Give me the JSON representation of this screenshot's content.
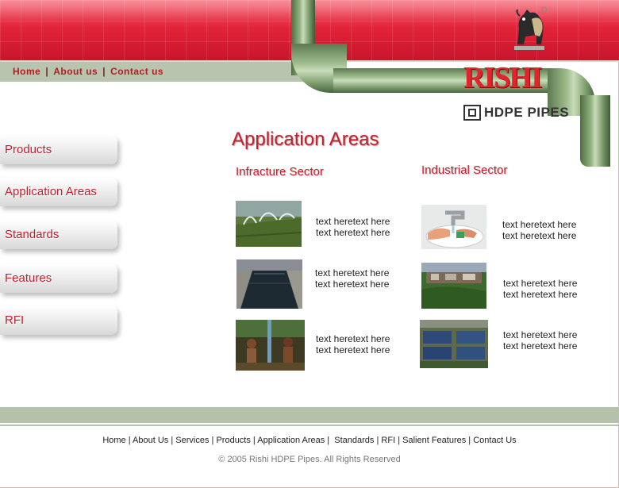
{
  "header": {
    "nav": [
      "Home",
      "About us",
      "Contact us"
    ],
    "nav_sep": "|",
    "logo": {
      "name": "RISHI",
      "subtitle": "HDPE PIPES"
    }
  },
  "sidebar": {
    "items": [
      {
        "label": "Products"
      },
      {
        "label": "Application Areas"
      },
      {
        "label": "Standards"
      },
      {
        "label": "Features"
      },
      {
        "label": "RFI"
      }
    ]
  },
  "main": {
    "title": "Application Areas",
    "sectors": [
      {
        "title": "Infracture Sector",
        "items": [
          {
            "image": "sprinkler-irrigation",
            "line1": "text heretext here",
            "line2": "text heretext here"
          },
          {
            "image": "water-channel",
            "line1": "text heretext here",
            "line2": "text heretext here"
          },
          {
            "image": "workers-pipe",
            "line1": "text heretext here",
            "line2": "text heretext here"
          }
        ]
      },
      {
        "title": "Industrial Sector",
        "items": [
          {
            "image": "hand-washing-tap",
            "line1": "text heretext here",
            "line2": "text heretext here"
          },
          {
            "image": "industrial-plant",
            "line1": "text heretext here",
            "line2": "text heretext here"
          },
          {
            "image": "treatment-tanks",
            "line1": "text heretext here",
            "line2": "text heretext here"
          }
        ]
      }
    ]
  },
  "footer": {
    "links": [
      "Home",
      "About Us",
      "Services",
      "Products",
      "Application Areas",
      "Standards",
      "RFI",
      "Salient Features",
      "Contact Us"
    ],
    "copyright": "© 2005 Rishi HDPE Pipes. All Rights Reserved"
  },
  "colors": {
    "brand_red": "#c8202e",
    "banner_red": "#e3243a",
    "pipe_green": "#8fb07f",
    "bar_green": "#b5c1ab"
  }
}
